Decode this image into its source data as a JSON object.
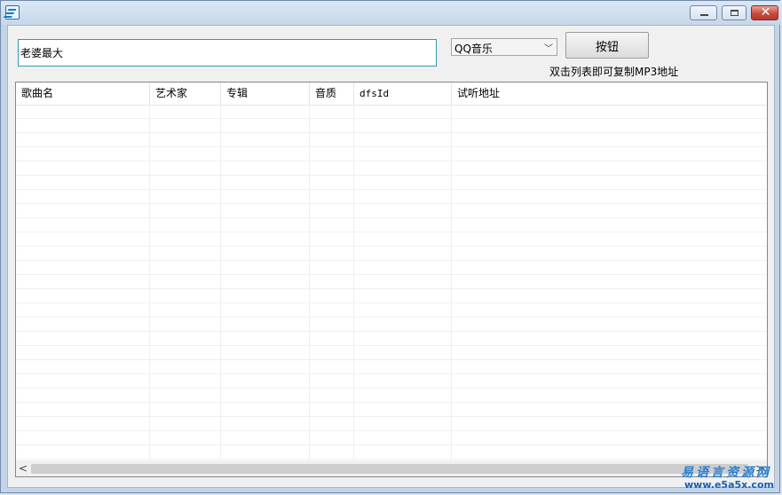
{
  "search": {
    "value": "老婆最大"
  },
  "source_select": {
    "selected": "QQ音乐"
  },
  "action_button": {
    "label": "按钮"
  },
  "hint": "双击列表即可复制MP3地址",
  "columns": [
    "歌曲名",
    "艺术家",
    "专辑",
    "音质",
    "dfsId",
    "试听地址"
  ],
  "watermark": {
    "line1": "易语言资源网",
    "line2": "www.e5a5x.com"
  },
  "icons": {
    "app": "app-icon",
    "minimize": "minimize-icon",
    "maximize": "maximize-icon",
    "close": "close-icon",
    "dropdown": "chevron-down-icon"
  }
}
